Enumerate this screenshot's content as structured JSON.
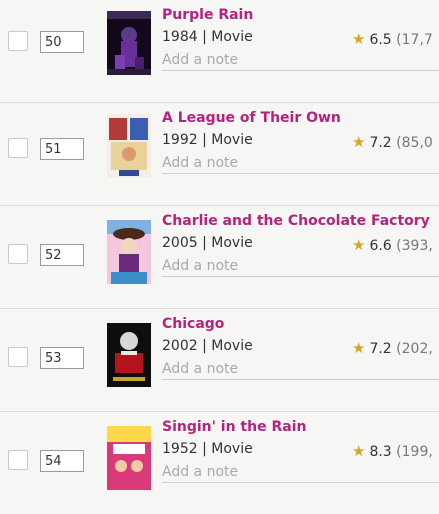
{
  "colors": {
    "title": "#b5237e",
    "star": "#d4a626",
    "meta": "#333333",
    "note": "#a9a9a9"
  },
  "icons": {
    "rating": "star-icon"
  },
  "items": [
    {
      "rank": "50",
      "title": "Purple Rain",
      "year": "1984",
      "type": "Movie",
      "rating": "6.5",
      "votes": "(17,7",
      "note_placeholder": "Add a note"
    },
    {
      "rank": "51",
      "title": "A League of Their Own",
      "year": "1992",
      "type": "Movie",
      "rating": "7.2",
      "votes": "(85,0",
      "note_placeholder": "Add a note"
    },
    {
      "rank": "52",
      "title": "Charlie and the Chocolate Factory",
      "year": "2005",
      "type": "Movie",
      "rating": "6.6",
      "votes": "(393,",
      "note_placeholder": "Add a note"
    },
    {
      "rank": "53",
      "title": "Chicago",
      "year": "2002",
      "type": "Movie",
      "rating": "7.2",
      "votes": "(202,",
      "note_placeholder": "Add a note"
    },
    {
      "rank": "54",
      "title": "Singin' in the Rain",
      "year": "1952",
      "type": "Movie",
      "rating": "8.3",
      "votes": "(199,",
      "note_placeholder": "Add a note"
    }
  ]
}
